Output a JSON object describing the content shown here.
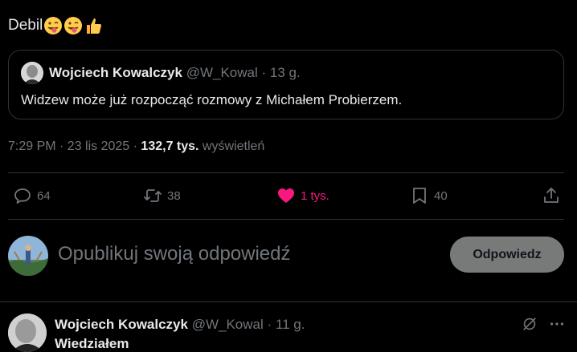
{
  "tweet": {
    "text": "Debil",
    "emojis": [
      "winking-tongue-face",
      "winking-tongue-face",
      "thumbs-up"
    ]
  },
  "quote": {
    "author_name": "Wojciech Kowalczyk",
    "handle": "@W_Kowal",
    "time": "· 13 g.",
    "text": "Widzew może już rozpocząć rozmowy z Michałem Probierzem."
  },
  "meta": {
    "time_date": "7:29 PM · 23 lis 2025 · ",
    "views_count": "132,7 tys.",
    "views_label": " wyświetleń"
  },
  "actions": {
    "replies": "64",
    "reposts": "38",
    "likes": "1 tys.",
    "bookmarks": "40",
    "like_color": "#f91880"
  },
  "composer": {
    "placeholder": "Opublikuj swoją odpowiedź",
    "button_label": "Odpowiedz"
  },
  "next_tweet": {
    "author_name": "Wojciech Kowalczyk",
    "handle": "@W_Kowal",
    "time": "· 11 g.",
    "text_partial": "Wiedziałem"
  }
}
